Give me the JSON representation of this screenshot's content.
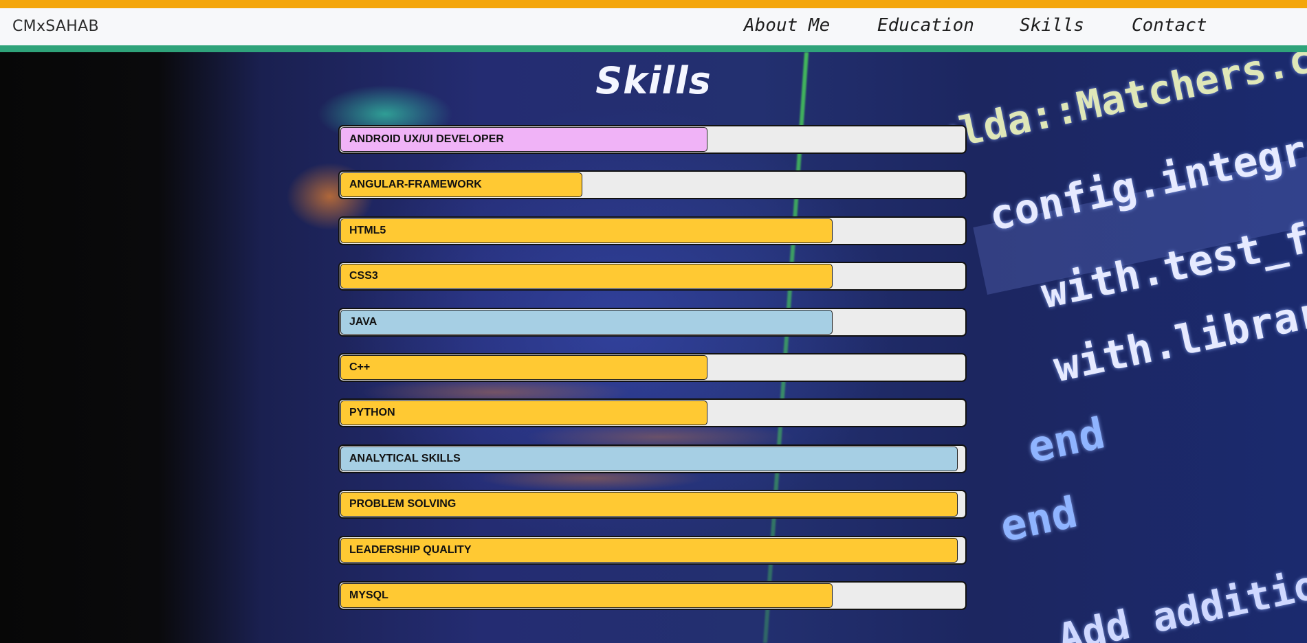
{
  "nav": {
    "brand": "CMxSAHAB",
    "links": [
      "About Me",
      "Education",
      "Skills",
      "Contact"
    ]
  },
  "colors": {
    "top_stripe": "#f4a60b",
    "bottom_stripe": "#2fa37a",
    "navbar_bg": "#f7f8fa",
    "track": "#ececec"
  },
  "skills": {
    "title": "Skills",
    "items": [
      {
        "label": "ANDROID UX/UI DEVELOPER",
        "level": 0.6,
        "color": "#f0b3f7"
      },
      {
        "label": "ANGULAR-FRAMEWORK",
        "level": 0.4,
        "color": "#ffc933"
      },
      {
        "label": "HTML5",
        "level": 0.8,
        "color": "#ffc933"
      },
      {
        "label": "CSS3",
        "level": 0.8,
        "color": "#ffc933"
      },
      {
        "label": "JAVA",
        "level": 0.8,
        "color": "#a6cfe4"
      },
      {
        "label": "C++",
        "level": 0.6,
        "color": "#ffc933"
      },
      {
        "label": "PYTHON",
        "level": 0.6,
        "color": "#ffc933"
      },
      {
        "label": "ANALYTICAL SKILLS",
        "level": 1.0,
        "color": "#a6cfe4"
      },
      {
        "label": "PROBLEM SOLVING",
        "level": 1.0,
        "color": "#ffc933"
      },
      {
        "label": "LEADERSHIP QUALITY",
        "level": 1.0,
        "color": "#ffc933"
      },
      {
        "label": "MYSQL",
        "level": 0.8,
        "color": "#ffc933"
      }
    ]
  },
  "background_code": [
    "ulda::Matchers.c",
    "config.integrate",
    "with.test_fran",
    "with.library",
    "end",
    "end",
    "Add additio"
  ]
}
